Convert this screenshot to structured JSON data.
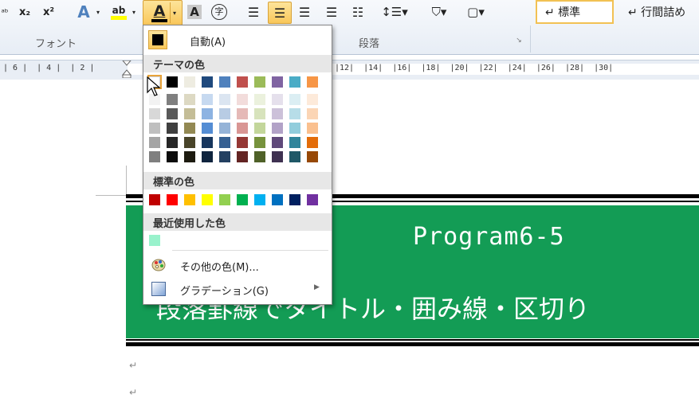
{
  "ribbon": {
    "font_group_label": "フォント",
    "paragraph_group_label": "段落",
    "style_normal": "↵ 標準",
    "style_nospacing": "↵ 行間詰め",
    "buttons": {
      "subscript": "x₂",
      "superscript": "x²",
      "text_effects": "A",
      "highlight": "ab",
      "font_color": "A",
      "char_shading": "A",
      "enclose_char": "字"
    }
  },
  "ruler": {
    "numbers": "| 6 |  | 4 |  | 2 |",
    "numbers_right": "|12|  |14|  |16|  |18|  |20|  |22|  |24|  |26|  |28|  |30|"
  },
  "dropdown": {
    "automatic_label": "自動(A)",
    "theme_colors_header": "テーマの色",
    "standard_colors_header": "標準の色",
    "recent_colors_header": "最近使用した色",
    "more_colors_label": "その他の色(M)...",
    "gradient_label": "グラデーション(G)",
    "theme_colors": [
      [
        "#ffffff",
        "#000000",
        "#eeece1",
        "#1f497d",
        "#4f81bd",
        "#c0504d",
        "#9bbb59",
        "#8064a2",
        "#4bacc6",
        "#f79646"
      ],
      [
        "#f2f2f2",
        "#7f7f7f",
        "#ddd9c3",
        "#c6d9f0",
        "#dbe5f1",
        "#f2dcdb",
        "#ebf1dd",
        "#e5e0ec",
        "#dbeef3",
        "#fdeada"
      ],
      [
        "#d8d8d8",
        "#595959",
        "#c4bd97",
        "#8db3e2",
        "#b8cce4",
        "#e5b9b7",
        "#d7e3bc",
        "#ccc1d9",
        "#b7dde8",
        "#fbd5b5"
      ],
      [
        "#bfbfbf",
        "#3f3f3f",
        "#938953",
        "#548dd4",
        "#95b3d7",
        "#d99694",
        "#c3d69b",
        "#b2a2c7",
        "#92cddc",
        "#fac08f"
      ],
      [
        "#a5a5a5",
        "#262626",
        "#494429",
        "#17365d",
        "#366092",
        "#953734",
        "#76923c",
        "#5f497a",
        "#31859b",
        "#e36c09"
      ],
      [
        "#7f7f7f",
        "#0c0c0c",
        "#1d1b10",
        "#0f243e",
        "#244061",
        "#632423",
        "#4f6128",
        "#3f3151",
        "#205867",
        "#974806"
      ]
    ],
    "standard_colors": [
      "#c00000",
      "#ff0000",
      "#ffc000",
      "#ffff00",
      "#92d050",
      "#00b050",
      "#00b0f0",
      "#0070c0",
      "#002060",
      "#7030a0"
    ],
    "recent_colors": [
      "#99f2cc"
    ]
  },
  "document": {
    "banner_title": "Program6-5",
    "banner_subtitle": "段落罫線でタイトル・囲み線・区切り",
    "banner_color": "#139c55",
    "paragraph_mark": "↵"
  }
}
